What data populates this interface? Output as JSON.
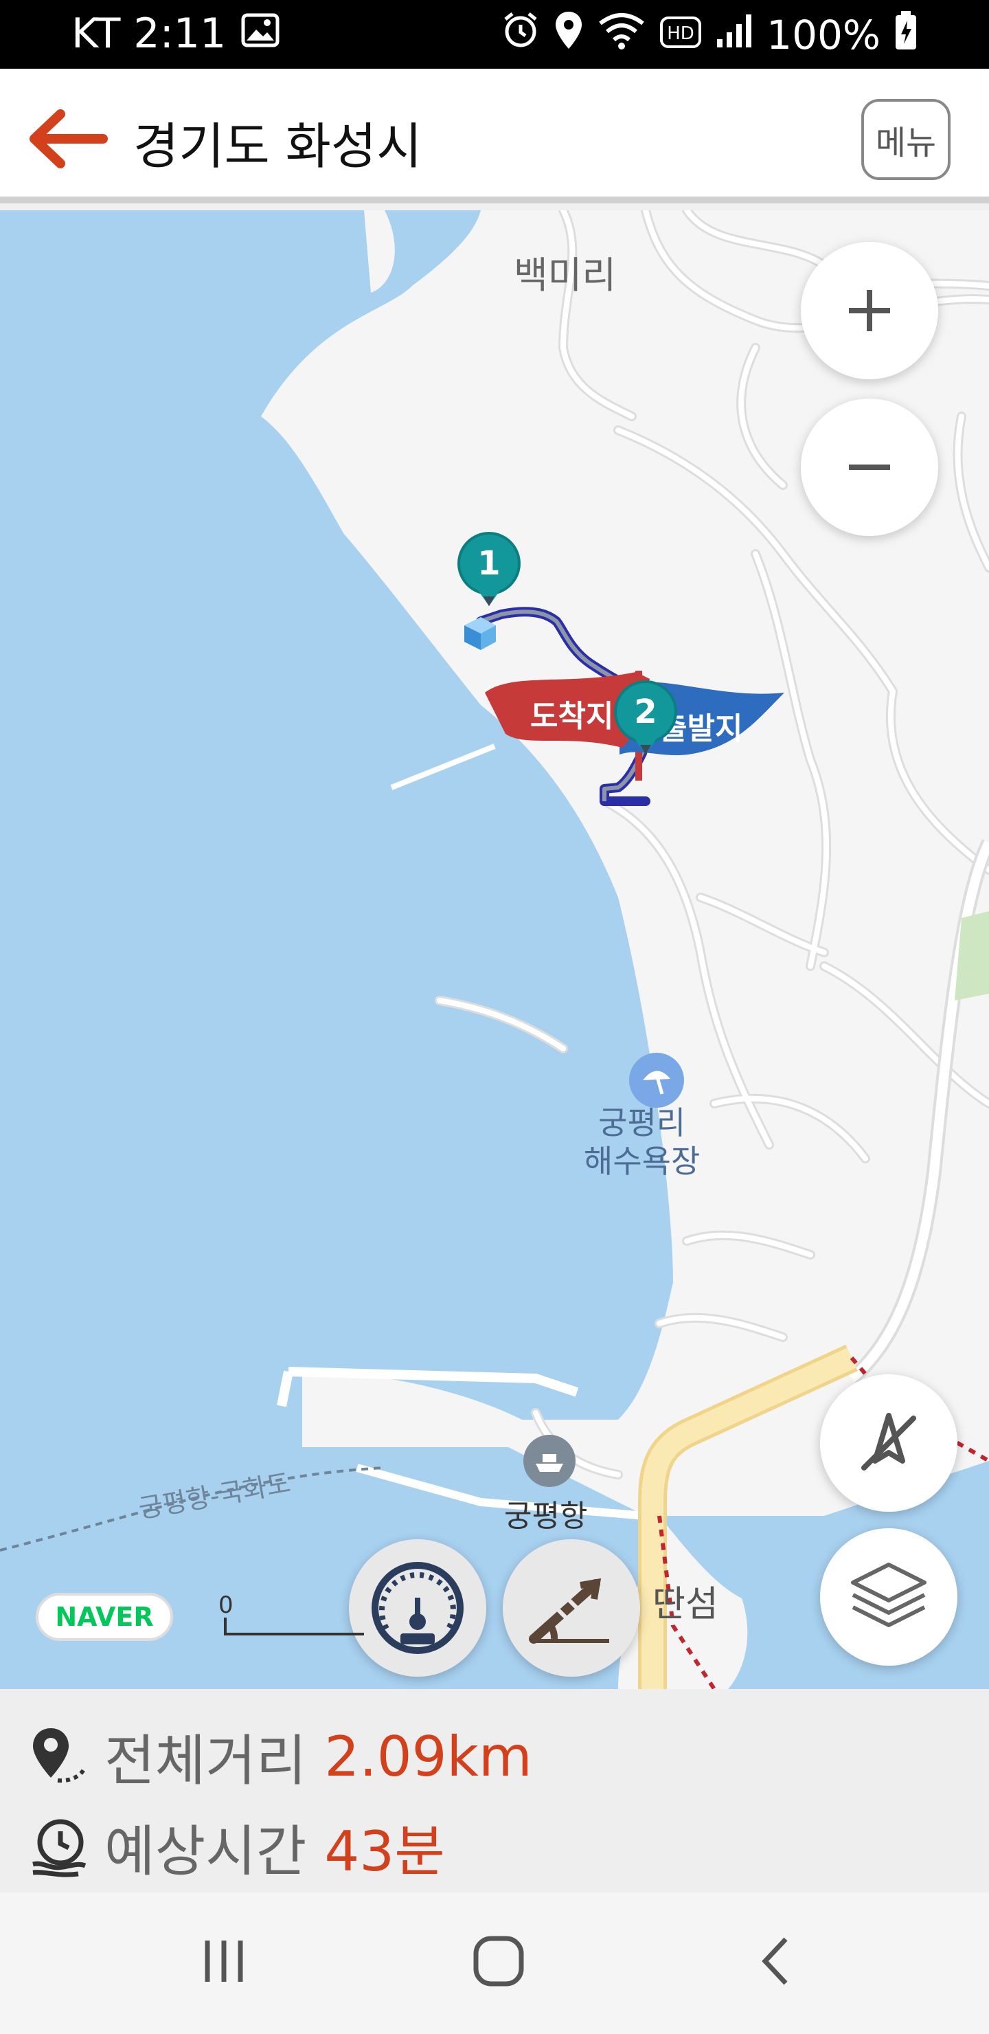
{
  "status_bar": {
    "carrier_time": "KT 2:11",
    "battery": "100%",
    "icons": [
      "image-icon",
      "alarm-icon",
      "location-icon",
      "wifi-icon",
      "hd-icon",
      "signal-icon",
      "battery-charging-icon"
    ]
  },
  "app_bar": {
    "title": "경기도 화성시",
    "menu_label": "메뉴",
    "back_icon": "back-arrow-icon"
  },
  "map": {
    "labels": {
      "village": "백미리",
      "beach": "궁평리\n해수욕장",
      "beach_line1": "궁평리",
      "beach_line2": "해수욕장",
      "port": "궁평항",
      "ferry": "궁평항-국화도",
      "island": "딴섬"
    },
    "markers": {
      "waypoint1": "1",
      "waypoint2": "2",
      "arrival_flag": "도착지",
      "departure_flag": "출발지"
    },
    "scale_label": "0",
    "naver_badge": "NAVER",
    "controls": [
      "zoom-in",
      "zoom-out",
      "compass",
      "speedometer",
      "slope",
      "layers"
    ]
  },
  "summary": {
    "distance_label": "전체거리",
    "distance_value": "2.09km",
    "time_label": "예상시간",
    "time_value": "43분"
  },
  "nav_bar": {
    "buttons": [
      "recent-apps",
      "home",
      "back"
    ]
  },
  "colors": {
    "accent": "#d2411c",
    "sea": "#a8d1f0",
    "land": "#f5f5f5",
    "route": "#2a2fa8",
    "arrival_flag": "#c73a3a",
    "departure_flag": "#2e6cc0",
    "marker": "#12979a"
  }
}
